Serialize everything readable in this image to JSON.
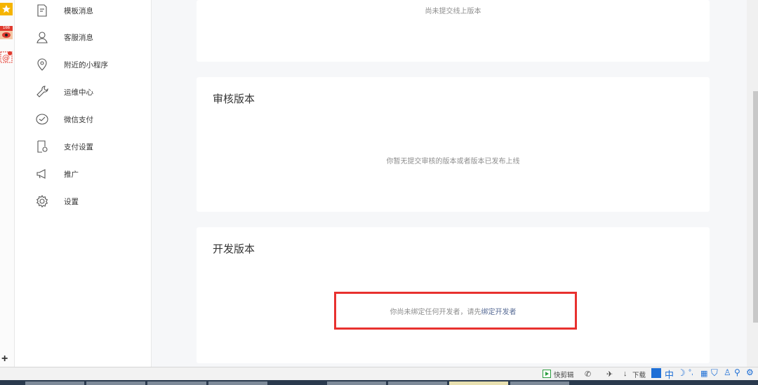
{
  "sidebar": {
    "items": [
      {
        "label": "模板消息",
        "icon": "template-message-icon"
      },
      {
        "label": "客服消息",
        "icon": "customer-service-icon"
      },
      {
        "label": "附近的小程序",
        "icon": "location-pin-icon"
      },
      {
        "label": "运维中心",
        "icon": "wrench-icon"
      },
      {
        "label": "微信支付",
        "icon": "wechat-pay-icon"
      },
      {
        "label": "支付设置",
        "icon": "payment-settings-icon"
      },
      {
        "label": "推广",
        "icon": "megaphone-icon"
      },
      {
        "label": "设置",
        "icon": "gear-icon"
      }
    ]
  },
  "online": {
    "message": "尚未提交线上版本"
  },
  "review": {
    "title": "审核版本",
    "message": "你暂无提交审核的版本或者版本已发布上线"
  },
  "dev": {
    "title": "开发版本",
    "message_prefix": "你尚未绑定任何开发者，请先",
    "message_link": "绑定开发者"
  },
  "strip": {
    "badge_count": "166"
  },
  "statusbar": {
    "clip": "快剪辑",
    "download": "下载",
    "ime_lang": "中"
  },
  "colors": {
    "highlight_box": "#e8312f",
    "link": "#576b95"
  }
}
